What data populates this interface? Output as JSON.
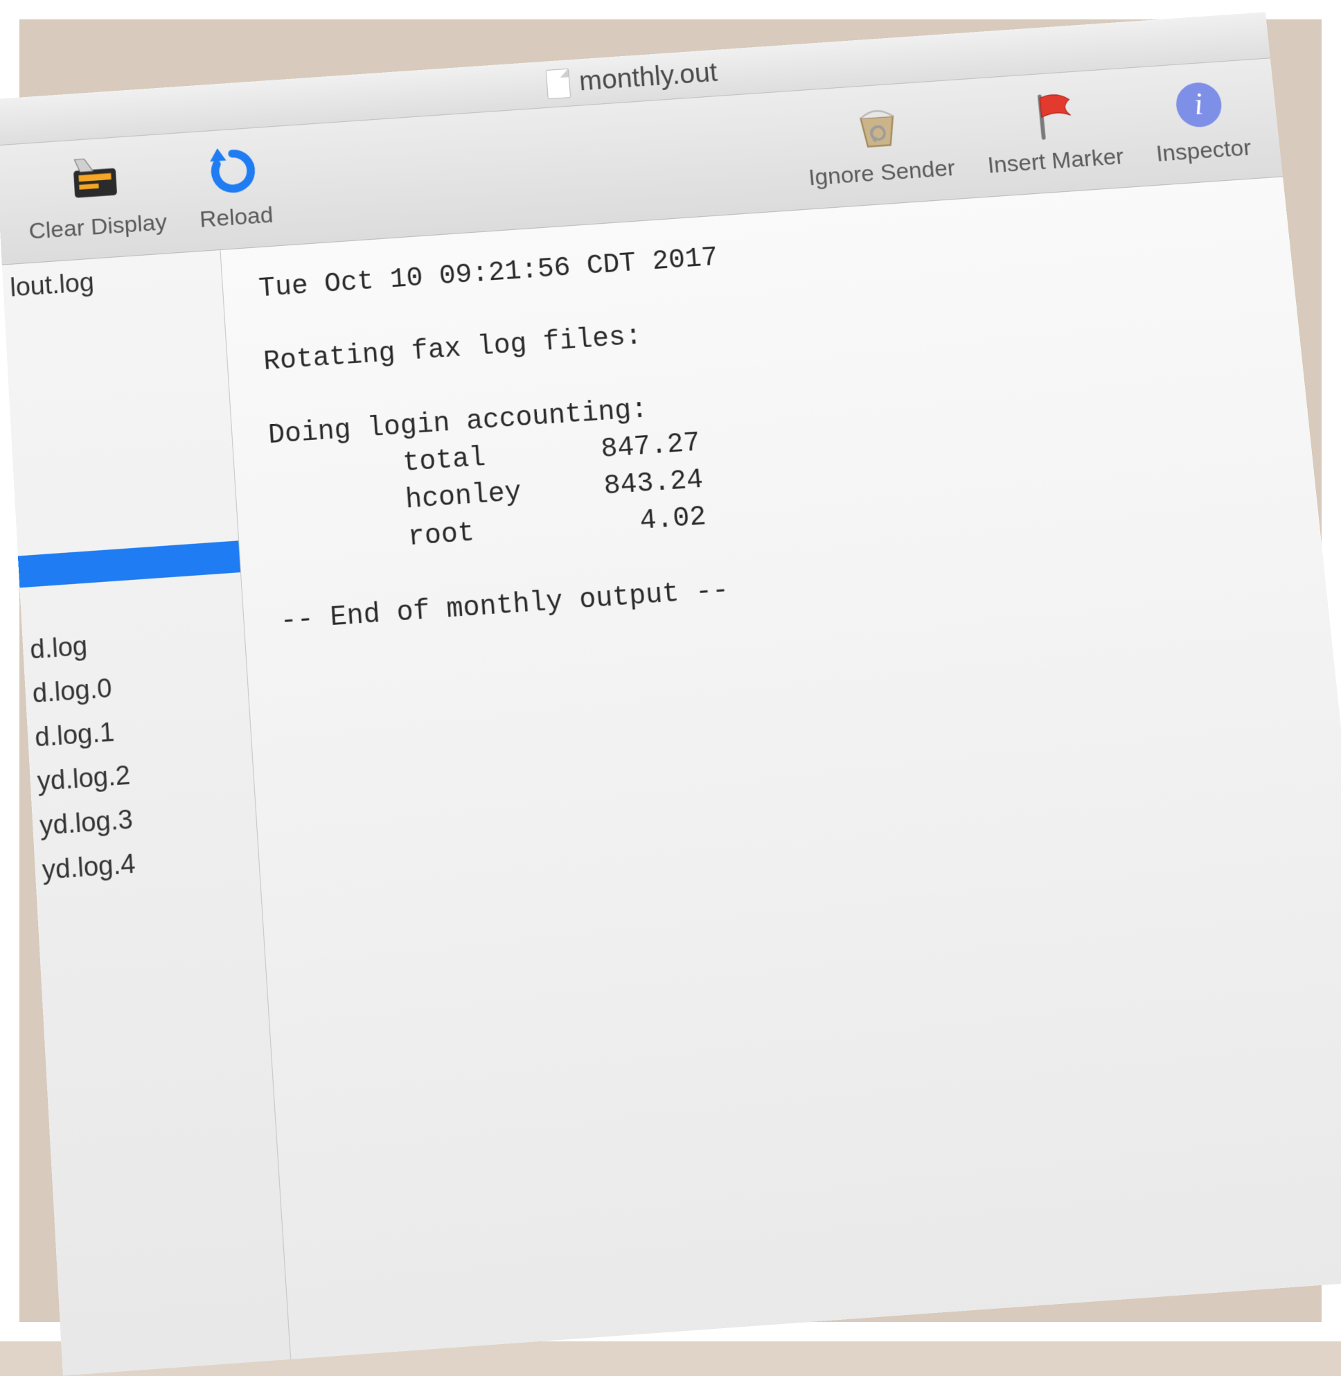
{
  "window": {
    "title": "monthly.out"
  },
  "toolbar": {
    "clear_display": "Clear Display",
    "reload": "Reload",
    "ignore_sender": "Ignore Sender",
    "insert_marker": "Insert Marker",
    "inspector": "Inspector"
  },
  "sidebar": {
    "items_top": [
      "lout.log"
    ],
    "items_bottom": [
      "d.log",
      "d.log.0",
      "d.log.1",
      "yd.log.2",
      "yd.log.3",
      "yd.log.4"
    ]
  },
  "log": {
    "timestamp": "Tue Oct 10 09:21:56 CDT 2017",
    "line1": "Rotating fax log files:",
    "line2": "Doing login accounting:",
    "accounting": [
      {
        "user": "total",
        "value": "847.27"
      },
      {
        "user": "hconley",
        "value": "843.24"
      },
      {
        "user": "root",
        "value": "4.02"
      }
    ],
    "footer": "-- End of monthly output --"
  }
}
